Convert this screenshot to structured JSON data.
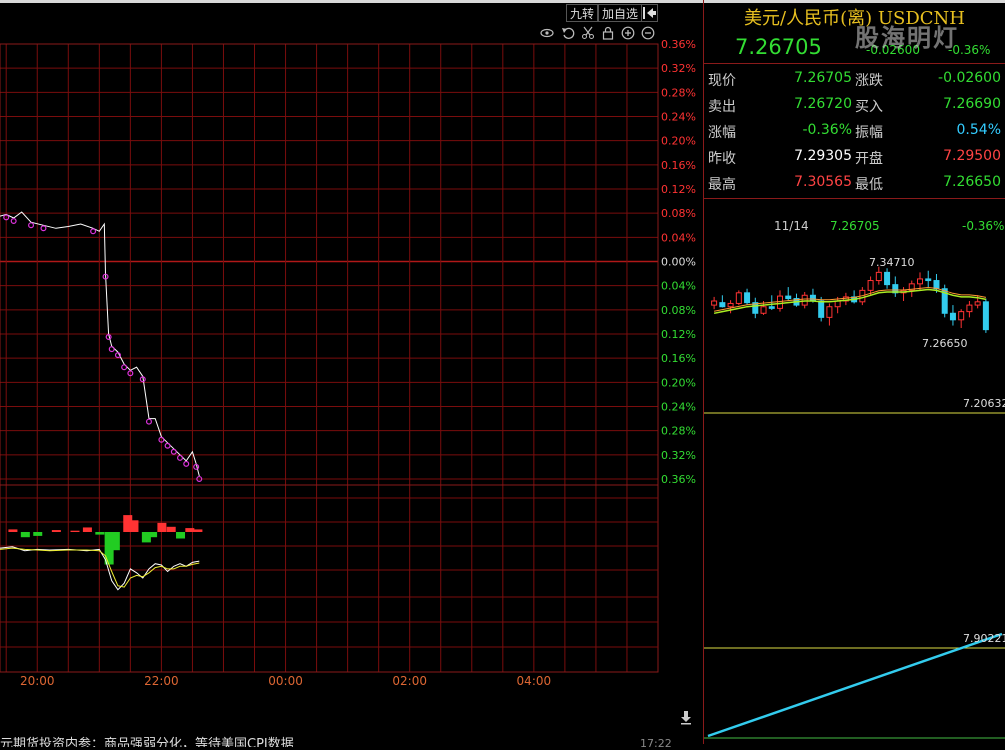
{
  "toolbar": {
    "nine_turn_label": "九转",
    "add_watch_label": "加自选",
    "icons": [
      "eye-icon",
      "undo-icon",
      "scissors-icon",
      "lock-icon",
      "zoom-in-icon",
      "zoom-out-icon"
    ]
  },
  "header": {
    "title": "美元/人民币(离) USDCNH",
    "price": "7.26705",
    "change": "-0.02600",
    "change_pct": "-0.36%",
    "watermark": "股海明灯"
  },
  "quote": {
    "rows": [
      {
        "l1": "现价",
        "v1": "7.26705",
        "c1": "#33dd33",
        "l2": "涨跌",
        "v2": "-0.02600",
        "c2": "#33dd33"
      },
      {
        "l1": "卖出",
        "v1": "7.26720",
        "c1": "#33dd33",
        "l2": "买入",
        "v2": "7.26690",
        "c2": "#33dd33"
      },
      {
        "l1": "涨幅",
        "v1": "-0.36%",
        "c1": "#33dd33",
        "l2": "振幅",
        "v2": "0.54%",
        "c2": "#33ccff"
      },
      {
        "l1": "昨收",
        "v1": "7.29305",
        "c1": "#ffffff",
        "l2": "开盘",
        "v2": "7.29500",
        "c2": "#ff4444"
      },
      {
        "l1": "最高",
        "v1": "7.30565",
        "c1": "#ff4444",
        "l2": "最低",
        "v2": "7.26650",
        "c2": "#33dd33"
      }
    ]
  },
  "mini": {
    "date": "11/14",
    "price": "7.26705",
    "pct": "-0.36%",
    "high_label": "7.34710",
    "low_label": "7.26650",
    "line1_value": "7.20632",
    "line2_value": "7.90221"
  },
  "ticker": {
    "text": "元期货投资内参：商品强弱分化，等待美国CPI数据",
    "time": "17:22"
  },
  "chart_data": {
    "type": "line",
    "title": "",
    "x_ticks": [
      "20:00",
      "22:00",
      "00:00",
      "02:00",
      "04:00"
    ],
    "y_ticks_pct": [
      "0.36%",
      "0.32%",
      "0.28%",
      "0.24%",
      "0.20%",
      "0.16%",
      "0.12%",
      "0.08%",
      "0.04%",
      "0.00%",
      "0.04%",
      "0.08%",
      "0.12%",
      "0.16%",
      "0.20%",
      "0.24%",
      "0.28%",
      "0.32%",
      "0.36%"
    ],
    "ylim_pct": [
      -0.36,
      0.36
    ],
    "x_hours_range": [
      19.4,
      30.0
    ],
    "series": [
      {
        "x": [
          19.4,
          19.5,
          19.62,
          19.75,
          19.9,
          20.1,
          20.3,
          20.5,
          20.7,
          20.9,
          21.0,
          21.08,
          21.1,
          21.15,
          21.2,
          21.3,
          21.4,
          21.5,
          21.6,
          21.7,
          21.8,
          21.9,
          22.0,
          22.1,
          22.2,
          22.3,
          22.4,
          22.5,
          22.56,
          22.61
        ],
        "y": [
          0.075,
          0.078,
          0.072,
          0.082,
          0.065,
          0.06,
          0.055,
          0.058,
          0.062,
          0.055,
          0.05,
          0.062,
          -0.02,
          -0.12,
          -0.14,
          -0.15,
          -0.17,
          -0.18,
          -0.175,
          -0.19,
          -0.26,
          -0.26,
          -0.29,
          -0.3,
          -0.31,
          -0.32,
          -0.33,
          -0.315,
          -0.335,
          -0.355
        ]
      }
    ]
  },
  "indicator_data": {
    "bars": [
      {
        "x": 19.6,
        "v": 0.2
      },
      {
        "x": 19.8,
        "v": -0.4
      },
      {
        "x": 20.0,
        "v": -0.3
      },
      {
        "x": 20.3,
        "v": 0.15
      },
      {
        "x": 20.6,
        "v": 0.1
      },
      {
        "x": 20.8,
        "v": 0.35
      },
      {
        "x": 21.0,
        "v": -0.2
      },
      {
        "x": 21.15,
        "v": -2.5
      },
      {
        "x": 21.25,
        "v": -1.4
      },
      {
        "x": 21.45,
        "v": 1.3
      },
      {
        "x": 21.55,
        "v": 0.9
      },
      {
        "x": 21.75,
        "v": -0.8
      },
      {
        "x": 21.85,
        "v": -0.4
      },
      {
        "x": 22.0,
        "v": 0.7
      },
      {
        "x": 22.15,
        "v": 0.4
      },
      {
        "x": 22.3,
        "v": -0.5
      },
      {
        "x": 22.45,
        "v": 0.3
      },
      {
        "x": 22.58,
        "v": 0.2
      }
    ],
    "dif": [
      [
        19.4,
        0.3
      ],
      [
        19.6,
        0.4
      ],
      [
        19.8,
        0.1
      ],
      [
        20.0,
        0.2
      ],
      [
        20.2,
        0.15
      ],
      [
        20.5,
        0.2
      ],
      [
        20.8,
        0.1
      ],
      [
        21.0,
        0.2
      ],
      [
        21.1,
        -0.6
      ],
      [
        21.2,
        -2.2
      ],
      [
        21.3,
        -2.9
      ],
      [
        21.4,
        -2.4
      ],
      [
        21.5,
        -1.3
      ],
      [
        21.6,
        -1.6
      ],
      [
        21.7,
        -2.0
      ],
      [
        21.8,
        -1.3
      ],
      [
        21.9,
        -0.9
      ],
      [
        22.0,
        -1.0
      ],
      [
        22.1,
        -1.5
      ],
      [
        22.2,
        -1.1
      ],
      [
        22.3,
        -0.9
      ],
      [
        22.4,
        -1.1
      ],
      [
        22.5,
        -0.8
      ],
      [
        22.61,
        -0.7
      ]
    ],
    "dea": [
      [
        19.4,
        0.2
      ],
      [
        19.6,
        0.3
      ],
      [
        19.8,
        0.2
      ],
      [
        20.0,
        0.15
      ],
      [
        20.2,
        0.1
      ],
      [
        20.5,
        0.15
      ],
      [
        20.8,
        0.15
      ],
      [
        21.0,
        0.1
      ],
      [
        21.1,
        -0.3
      ],
      [
        21.2,
        -1.5
      ],
      [
        21.3,
        -2.6
      ],
      [
        21.4,
        -2.7
      ],
      [
        21.5,
        -2.0
      ],
      [
        21.6,
        -1.8
      ],
      [
        21.7,
        -1.9
      ],
      [
        21.8,
        -1.6
      ],
      [
        21.9,
        -1.2
      ],
      [
        22.0,
        -1.1
      ],
      [
        22.1,
        -1.3
      ],
      [
        22.2,
        -1.3
      ],
      [
        22.3,
        -1.1
      ],
      [
        22.4,
        -1.1
      ],
      [
        22.5,
        -0.95
      ],
      [
        22.61,
        -0.85
      ]
    ]
  },
  "mini_candles": {
    "ylim": [
      7.25,
      7.36
    ],
    "candles": [
      [
        7.3,
        7.31,
        7.295,
        7.305
      ],
      [
        7.303,
        7.312,
        7.297,
        7.298
      ],
      [
        7.298,
        7.306,
        7.29,
        7.302
      ],
      [
        7.302,
        7.318,
        7.3,
        7.315
      ],
      [
        7.315,
        7.32,
        7.3,
        7.303
      ],
      [
        7.303,
        7.309,
        7.284,
        7.29
      ],
      [
        7.29,
        7.305,
        7.288,
        7.298
      ],
      [
        7.298,
        7.312,
        7.294,
        7.296
      ],
      [
        7.296,
        7.318,
        7.292,
        7.311
      ],
      [
        7.311,
        7.322,
        7.305,
        7.308
      ],
      [
        7.308,
        7.314,
        7.298,
        7.3
      ],
      [
        7.3,
        7.316,
        7.296,
        7.312
      ],
      [
        7.312,
        7.32,
        7.303,
        7.305
      ],
      [
        7.305,
        7.31,
        7.28,
        7.285
      ],
      [
        7.285,
        7.302,
        7.275,
        7.298
      ],
      [
        7.298,
        7.31,
        7.29,
        7.305
      ],
      [
        7.305,
        7.315,
        7.3,
        7.31
      ],
      [
        7.31,
        7.318,
        7.302,
        7.304
      ],
      [
        7.304,
        7.322,
        7.3,
        7.318
      ],
      [
        7.318,
        7.335,
        7.312,
        7.33
      ],
      [
        7.33,
        7.347,
        7.325,
        7.34
      ],
      [
        7.34,
        7.345,
        7.32,
        7.325
      ],
      [
        7.325,
        7.335,
        7.31,
        7.315
      ],
      [
        7.315,
        7.322,
        7.305,
        7.318
      ],
      [
        7.318,
        7.33,
        7.31,
        7.326
      ],
      [
        7.326,
        7.34,
        7.318,
        7.332
      ],
      [
        7.332,
        7.342,
        7.322,
        7.33
      ],
      [
        7.33,
        7.338,
        7.315,
        7.32
      ],
      [
        7.32,
        7.325,
        7.285,
        7.29
      ],
      [
        7.29,
        7.3,
        7.275,
        7.282
      ],
      [
        7.282,
        7.295,
        7.272,
        7.292
      ],
      [
        7.292,
        7.305,
        7.285,
        7.3
      ],
      [
        7.3,
        7.312,
        7.296,
        7.304
      ],
      [
        7.304,
        7.308,
        7.266,
        7.27
      ]
    ],
    "ma": [
      7.29,
      7.292,
      7.294,
      7.296,
      7.298,
      7.299,
      7.3,
      7.301,
      7.302,
      7.303,
      7.304,
      7.305,
      7.305,
      7.304,
      7.304,
      7.305,
      7.306,
      7.307,
      7.309,
      7.312,
      7.315,
      7.316,
      7.316,
      7.316,
      7.317,
      7.318,
      7.319,
      7.318,
      7.315,
      7.312,
      7.31,
      7.31,
      7.309,
      7.307
    ],
    "lower_line": [
      0.05,
      0.95
    ]
  }
}
